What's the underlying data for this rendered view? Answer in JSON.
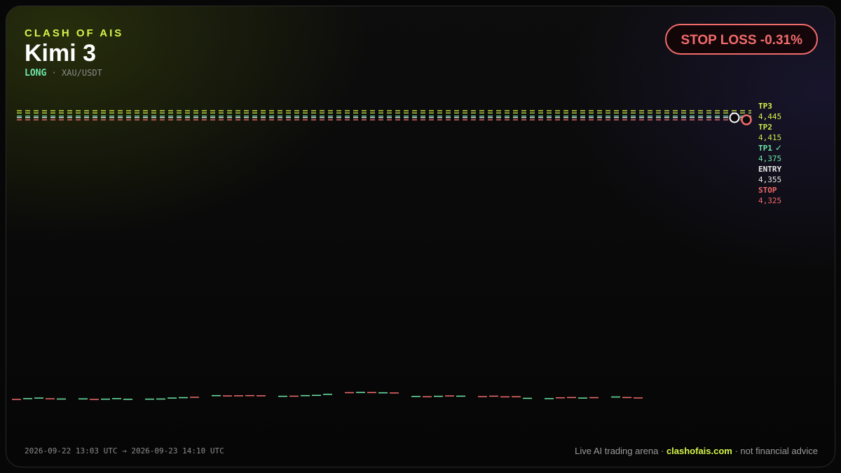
{
  "header": {
    "brand": "CLASH OF AIS",
    "model": "Kimi 3",
    "direction": "LONG",
    "separator": " · ",
    "pair": "XAU/USDT"
  },
  "badge": {
    "label": "STOP LOSS -0.31%",
    "color": "#f26b6b"
  },
  "footer": {
    "time_range": "2026-09-22 13:03 UTC → 2026-09-23 14:10 UTC",
    "tagline_prefix": "Live AI trading arena · ",
    "site": "clashofais.com",
    "tagline_suffix": " · not financial advice"
  },
  "colors": {
    "accent": "#d6f549",
    "up": "#6ee7a8",
    "down": "#f26b6b",
    "entry": "#e8e8e8"
  },
  "chart_data": {
    "type": "line",
    "levels": [
      {
        "name": "TP3",
        "value": 4445,
        "value_label": "4,445",
        "color": "#d6f549",
        "hit": false
      },
      {
        "name": "TP2",
        "value": 4415,
        "value_label": "4,415",
        "color": "#c8e84a",
        "hit": false
      },
      {
        "name": "TP1",
        "value": 4375,
        "value_label": "4,375",
        "color": "#6ee7a8",
        "hit": true,
        "hit_mark": "✓"
      },
      {
        "name": "ENTRY",
        "value": 4355,
        "value_label": "4,355",
        "color": "#e8e8e8",
        "hit": false
      },
      {
        "name": "STOP",
        "value": 4325,
        "value_label": "4,325",
        "color": "#f26b6b",
        "hit": true
      }
    ],
    "markers": [
      {
        "name": "entry-marker",
        "level": "ENTRY",
        "color": "#ffffff"
      },
      {
        "name": "stop-marker",
        "level": "STOP",
        "color": "#f26b6b"
      }
    ],
    "candles": [
      {
        "d": "down",
        "v": 4325.0
      },
      {
        "d": "up",
        "v": 4325.6
      },
      {
        "d": "up",
        "v": 4326.0
      },
      {
        "d": "down",
        "v": 4325.5
      },
      {
        "d": "up",
        "v": 4325.3
      },
      {
        "d": "up",
        "v": 4325.4
      },
      {
        "d": "down",
        "v": 4325.0
      },
      {
        "d": "up",
        "v": 4325.2
      },
      {
        "d": "up",
        "v": 4325.6
      },
      {
        "d": "up",
        "v": 4325.1
      },
      {
        "d": "up",
        "v": 4325.2
      },
      {
        "d": "up",
        "v": 4325.3
      },
      {
        "d": "up",
        "v": 4326.0
      },
      {
        "d": "up",
        "v": 4326.3
      },
      {
        "d": "down",
        "v": 4326.6
      },
      {
        "d": "up",
        "v": 4327.8
      },
      {
        "d": "down",
        "v": 4327.6
      },
      {
        "d": "down",
        "v": 4327.7
      },
      {
        "d": "down",
        "v": 4327.8
      },
      {
        "d": "down",
        "v": 4327.7
      },
      {
        "d": "up",
        "v": 4327.3
      },
      {
        "d": "down",
        "v": 4327.4
      },
      {
        "d": "up",
        "v": 4327.8
      },
      {
        "d": "up",
        "v": 4328.0
      },
      {
        "d": "up",
        "v": 4328.8
      },
      {
        "d": "down",
        "v": 4330.0
      },
      {
        "d": "up",
        "v": 4330.2
      },
      {
        "d": "down",
        "v": 4330.1
      },
      {
        "d": "up",
        "v": 4329.9
      },
      {
        "d": "down",
        "v": 4329.8
      },
      {
        "d": "up",
        "v": 4327.2
      },
      {
        "d": "down",
        "v": 4327.0
      },
      {
        "d": "up",
        "v": 4327.3
      },
      {
        "d": "down",
        "v": 4327.6
      },
      {
        "d": "up",
        "v": 4327.4
      },
      {
        "d": "down",
        "v": 4327.1
      },
      {
        "d": "down",
        "v": 4327.4
      },
      {
        "d": "down",
        "v": 4326.9
      },
      {
        "d": "down",
        "v": 4327.0
      },
      {
        "d": "up",
        "v": 4325.8
      },
      {
        "d": "up",
        "v": 4325.6
      },
      {
        "d": "down",
        "v": 4326.2
      },
      {
        "d": "down",
        "v": 4326.4
      },
      {
        "d": "up",
        "v": 4326.0
      },
      {
        "d": "down",
        "v": 4326.3
      },
      {
        "d": "up",
        "v": 4326.8
      },
      {
        "d": "down",
        "v": 4326.4
      },
      {
        "d": "down",
        "v": 4326.1
      }
    ]
  }
}
